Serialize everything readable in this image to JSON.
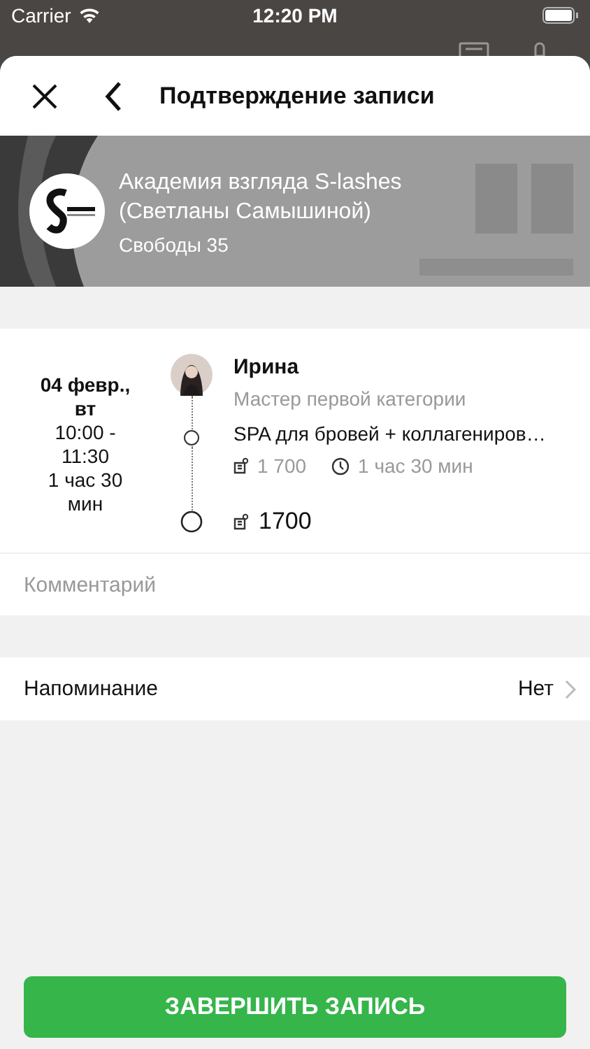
{
  "status_bar": {
    "carrier": "Carrier",
    "time": "12:20 PM"
  },
  "header": {
    "title": "Подтверждение записи"
  },
  "salon": {
    "name": "Академия взгляда S-lashes (Светланы Самышиной)",
    "address": "Свободы 35"
  },
  "appointment": {
    "date": "04 февр., вт",
    "time": "10:00 - 11:30",
    "duration": "1 час 30 мин",
    "master": {
      "name": "Ирина",
      "role": "Мастер первой  категории"
    },
    "services": [
      {
        "name": "SPA для бровей + коллагениров…",
        "price": "1 700",
        "duration": "1 час 30 мин"
      }
    ],
    "total": "1700"
  },
  "comment": {
    "placeholder": "Комментарий"
  },
  "reminder": {
    "label": "Напоминание",
    "value": "Нет"
  },
  "submit": {
    "label": "ЗАВЕРШИТЬ ЗАПИСЬ"
  }
}
